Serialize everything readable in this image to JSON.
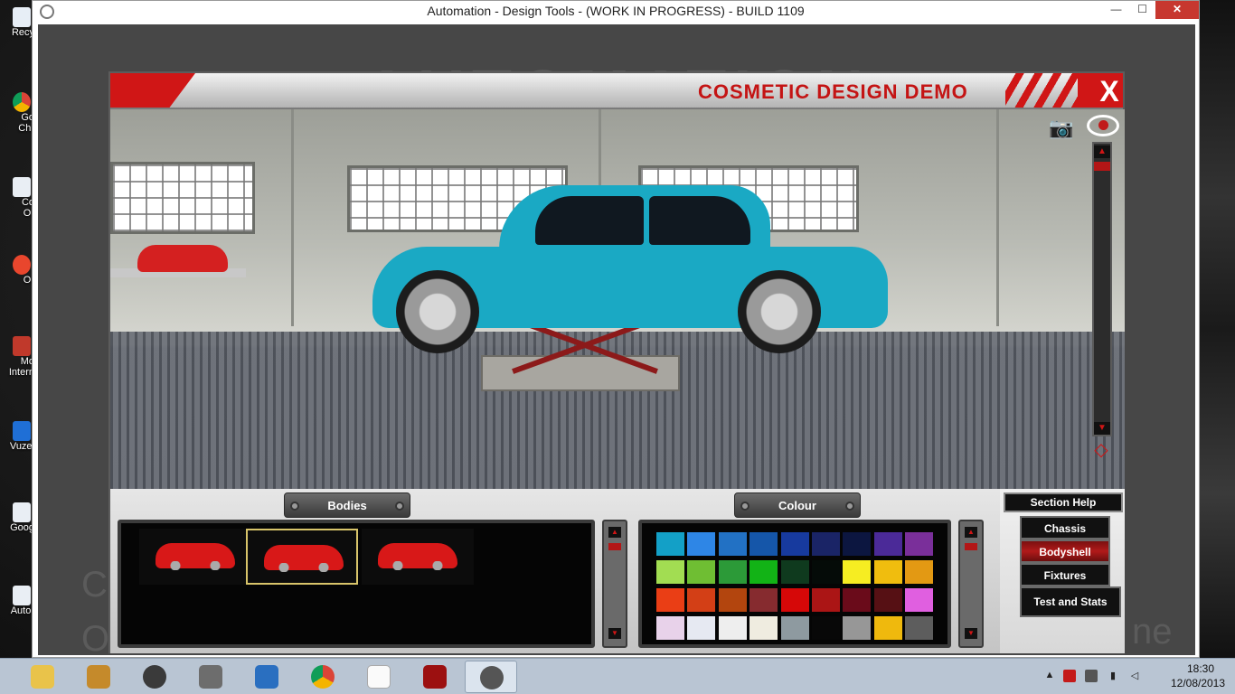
{
  "window": {
    "title": "Automation - Design Tools - (WORK IN PROGRESS) - BUILD 1109",
    "min": "—",
    "max": "☐",
    "close": "✕"
  },
  "panel": {
    "title": "COSMETIC DESIGN DEMO",
    "close": "X"
  },
  "tabs": {
    "bodies": "Bodies",
    "colour": "Colour"
  },
  "bodies": [
    {
      "name": "hatchback-body",
      "selected": false
    },
    {
      "name": "sedan-body",
      "selected": true
    },
    {
      "name": "coupe-body",
      "selected": false
    }
  ],
  "colours": [
    [
      "#13a0c7",
      "#2e86e6",
      "#2271c4",
      "#1556a9",
      "#173a9e",
      "#1a2466",
      "#0c1640",
      "#4b2a98",
      "#7a2f9a"
    ],
    [
      "#a2dd52",
      "#6fbe33",
      "#2c9a38",
      "#12b316",
      "#0f3a1e",
      "#050b08",
      "#f6ed22",
      "#f0bd0e",
      "#e39913"
    ],
    [
      "#ea3e15",
      "#d33f16",
      "#b3450e",
      "#862b2f",
      "#d60808",
      "#ab1515",
      "#6a0b1a",
      "#561014",
      "#e05fe0"
    ],
    [
      "#e8d2ea",
      "#e6e9f2",
      "#eeeeee",
      "#efece0",
      "#8e9aa0",
      "#080808",
      "#979797",
      "#efb90d",
      "#5d5d5d"
    ]
  ],
  "nav": {
    "help": "Section Help",
    "chassis": "Chassis",
    "bodyshell": "Bodyshell",
    "fixtures": "Fixtures",
    "test": "Test and Stats"
  },
  "background": {
    "watermark": "AUTOMATION",
    "left": "C\nO",
    "right": "ne"
  },
  "desktop": {
    "icons": [
      "Recy",
      "Go\nChr",
      "Co\nOr",
      "Or",
      "Mo\nIntern",
      "Vuzel",
      "Goog",
      "Autor"
    ]
  },
  "taskbar": {
    "apps": [
      "file-explorer",
      "automation-app",
      "speaker-app",
      "doc-app",
      "settings-app",
      "chrome",
      "blank-file",
      "power-app",
      "automation-launcher"
    ],
    "time": "18:30",
    "date": "12/08/2013"
  },
  "colors": {
    "accent_red": "#d01616",
    "car_teal": "#1aa9c4",
    "taskbar": "#b9c5d3"
  }
}
